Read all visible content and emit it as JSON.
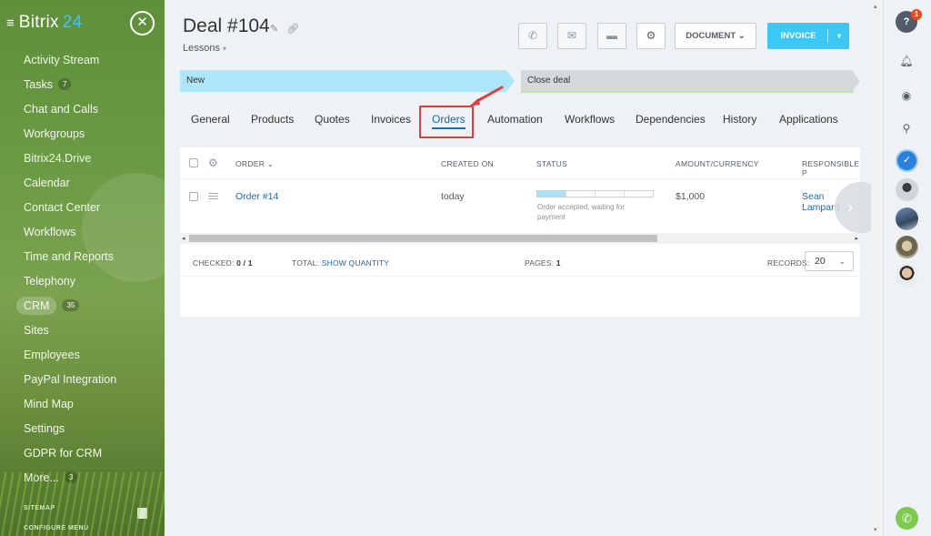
{
  "sidebar": {
    "logo_main": "Bitrix",
    "logo_num": "24",
    "items": [
      {
        "label": "Activity Stream",
        "count": ""
      },
      {
        "label": "Tasks",
        "count": "7"
      },
      {
        "label": "Chat and Calls",
        "count": ""
      },
      {
        "label": "Workgroups",
        "count": ""
      },
      {
        "label": "Bitrix24.Drive",
        "count": ""
      },
      {
        "label": "Calendar",
        "count": ""
      },
      {
        "label": "Contact Center",
        "count": ""
      },
      {
        "label": "Workflows",
        "count": ""
      },
      {
        "label": "Time and Reports",
        "count": ""
      },
      {
        "label": "Telephony",
        "count": ""
      },
      {
        "label": "CRM",
        "count": "35"
      },
      {
        "label": "Sites",
        "count": ""
      },
      {
        "label": "Employees",
        "count": ""
      },
      {
        "label": "PayPal Integration",
        "count": ""
      },
      {
        "label": "Mind Map",
        "count": ""
      },
      {
        "label": "Settings",
        "count": ""
      },
      {
        "label": "GDPR for CRM",
        "count": ""
      },
      {
        "label": "More...",
        "count": "3"
      }
    ],
    "sitemap": "SITEMAP",
    "configure": "CONFIGURE MENU"
  },
  "header": {
    "title": "Deal #104",
    "subtitle": "Lessons",
    "document_label": "DOCUMENT",
    "invoice_label": "INVOICE"
  },
  "stages": {
    "current": "New",
    "final": "Close deal"
  },
  "tabs": [
    "General",
    "Products",
    "Quotes",
    "Invoices",
    "Orders",
    "Automation",
    "Workflows",
    "Dependencies",
    "History",
    "Applications"
  ],
  "active_tab": "Orders",
  "table": {
    "columns": [
      "ORDER",
      "CREATED ON",
      "STATUS",
      "AMOUNT/CURRENCY",
      "RESPONSIBLE P"
    ],
    "rows": [
      {
        "order": "Order #14",
        "created_on": "today",
        "status": "Order accepted, waiting for payment",
        "amount": "$1,000",
        "responsible": "Sean Lampard"
      }
    ],
    "status_progress": 0.25,
    "footer": {
      "checked_label": "CHECKED:",
      "checked_value": "0 / 1",
      "total_label": "TOTAL:",
      "total_value": "SHOW QUANTITY",
      "pages_label": "PAGES:",
      "pages_value": "1",
      "records_label": "RECORDS:",
      "records_value": "20"
    }
  },
  "rail": {
    "help_badge": "1"
  },
  "colors": {
    "accent": "#3bc8f5",
    "link": "#2067b0",
    "highlight": "#e03c3c"
  }
}
